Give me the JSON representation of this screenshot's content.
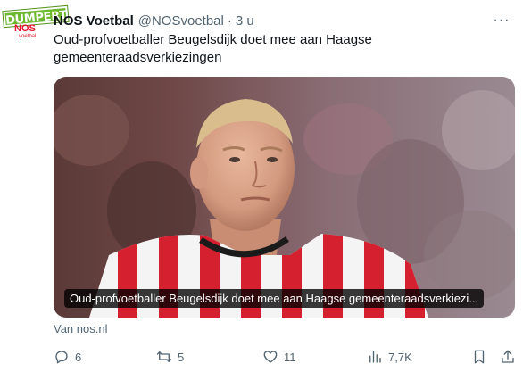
{
  "avatar": {
    "badge_text": "DUMPERT",
    "logo_text": "NOS",
    "logo_subtext": "voetbal"
  },
  "header": {
    "name": "NOS Voetbal",
    "handle": "@NOSvoetbal",
    "separator": "·",
    "time": "3 u",
    "more_icon": "···"
  },
  "tweet": {
    "text": "Oud-profvoetballer Beugelsdijk doet mee aan Haagse gemeenteraadsverkiezingen"
  },
  "card": {
    "caption": "Oud-profvoetballer Beugelsdijk doet mee aan Haagse gemeenteraadsverkiezi...",
    "source": "Van nos.nl"
  },
  "actions": {
    "replies": "6",
    "reposts": "5",
    "likes": "11",
    "views": "7,7K"
  },
  "colors": {
    "text_primary": "#0f1419",
    "text_secondary": "#536471",
    "dumpert_green": "#6cb82f",
    "nos_red": "#e5142d",
    "shirt_red": "#d4202f"
  }
}
